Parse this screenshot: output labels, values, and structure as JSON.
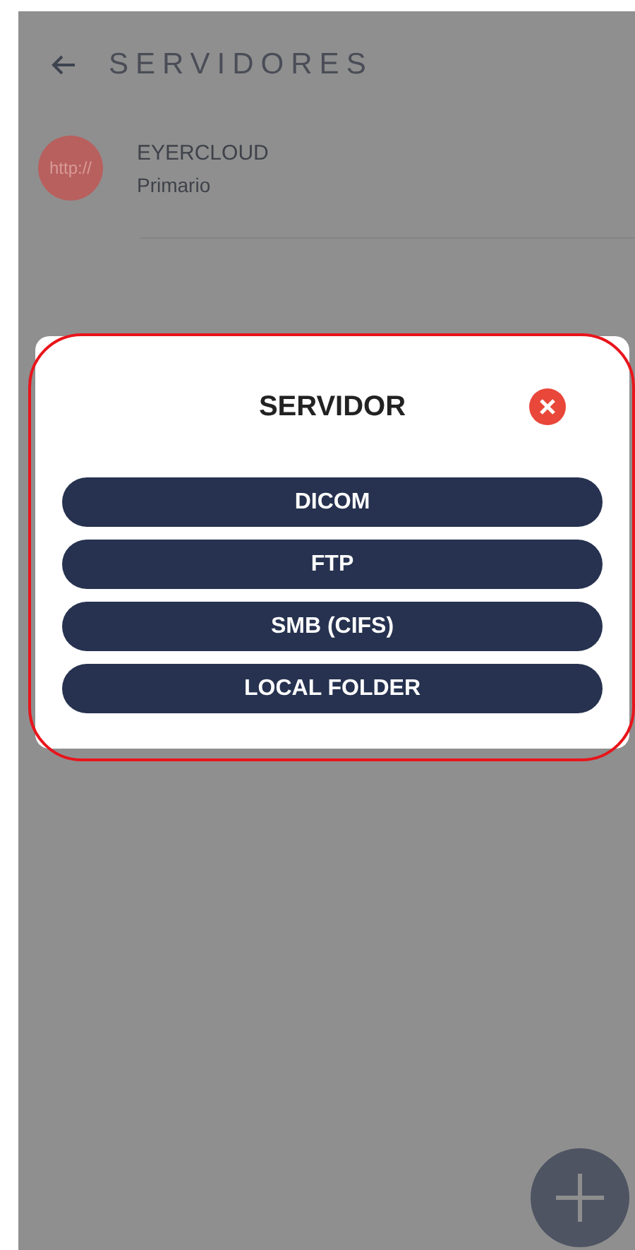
{
  "header": {
    "title": "SERVIDORES"
  },
  "servers": [
    {
      "badge": "http://",
      "name": "EYERCLOUD",
      "subtitle": "Primario"
    }
  ],
  "dialog": {
    "title": "SERVIDOR",
    "options": [
      {
        "label": "DICOM"
      },
      {
        "label": "FTP"
      },
      {
        "label": "SMB (CIFS)"
      },
      {
        "label": "LOCAL FOLDER"
      }
    ]
  }
}
